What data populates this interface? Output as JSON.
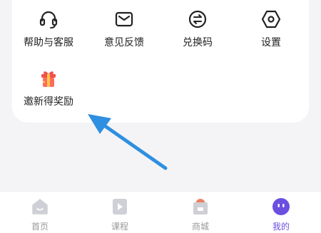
{
  "menu": {
    "items": [
      {
        "label": "帮助与客服",
        "icon": "headset-icon"
      },
      {
        "label": "意见反馈",
        "icon": "mail-icon"
      },
      {
        "label": "兑换码",
        "icon": "exchange-icon"
      },
      {
        "label": "设置",
        "icon": "settings-icon"
      },
      {
        "label": "邀新得奖励",
        "icon": "gift-icon"
      }
    ]
  },
  "tabbar": {
    "tabs": [
      {
        "label": "首页",
        "icon": "home-icon"
      },
      {
        "label": "课程",
        "icon": "play-icon"
      },
      {
        "label": "商城",
        "icon": "shop-icon"
      },
      {
        "label": "我的",
        "icon": "profile-face-icon",
        "active": true
      }
    ]
  },
  "colors": {
    "accent": "#6b4fe0",
    "annotation_arrow": "#2f8fe0",
    "gift": "#f0504a",
    "inactive_icon": "#cfcfd6"
  }
}
